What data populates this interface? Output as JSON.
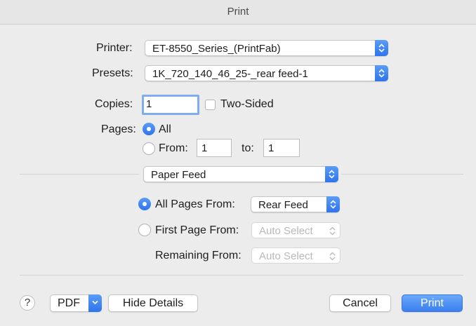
{
  "window": {
    "title": "Print"
  },
  "printer": {
    "label": "Printer:",
    "value": "ET-8550_Series_(PrintFab)"
  },
  "presets": {
    "label": "Presets:",
    "value": "1K_720_140_46_25-_rear feed-1"
  },
  "copies": {
    "label": "Copies:",
    "value": "1",
    "two_sided_label": "Two-Sided"
  },
  "pages": {
    "label": "Pages:",
    "all_label": "All",
    "from_label": "From:",
    "from_value": "1",
    "to_label": "to:",
    "to_value": "1"
  },
  "section": {
    "value": "Paper Feed"
  },
  "paper_feed": {
    "all_pages_label": "All Pages From:",
    "all_pages_value": "Rear Feed",
    "first_page_label": "First Page From:",
    "first_page_value": "Auto Select",
    "remaining_label": "Remaining From:",
    "remaining_value": "Auto Select"
  },
  "footer": {
    "help_label": "?",
    "pdf_label": "PDF",
    "hide_details_label": "Hide Details",
    "cancel_label": "Cancel",
    "print_label": "Print"
  },
  "colors": {
    "accent": "#2e74ec",
    "background": "#ececec"
  }
}
